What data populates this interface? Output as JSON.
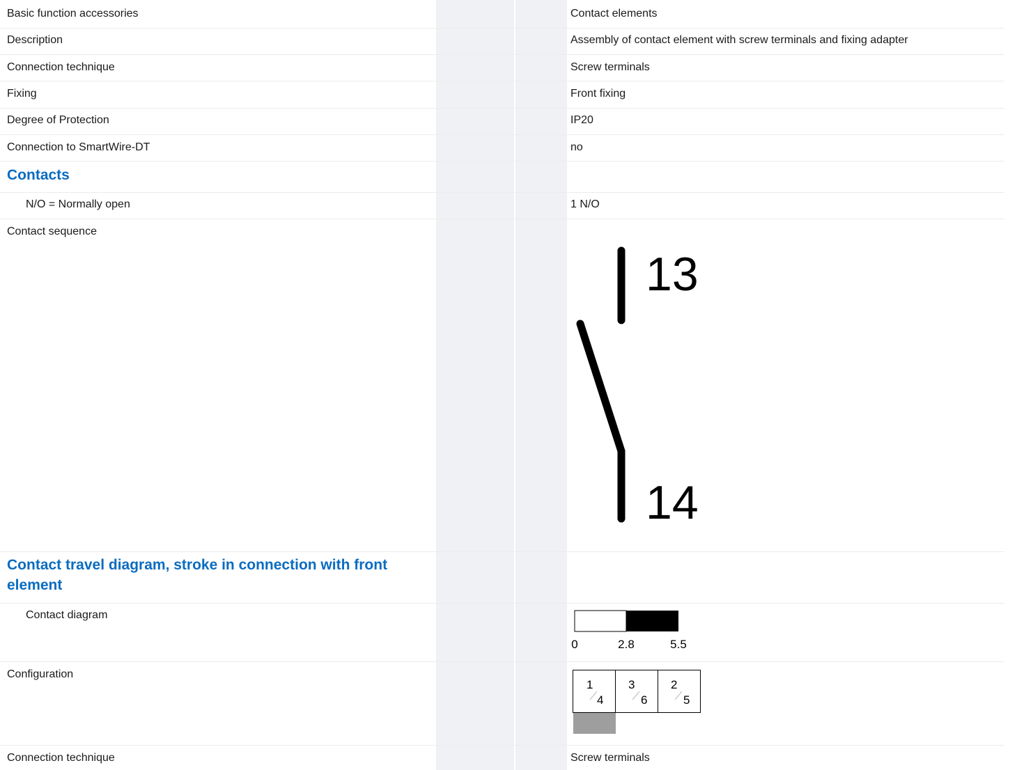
{
  "rows": {
    "basic_function": {
      "label": "Basic function accessories",
      "value": "Contact elements"
    },
    "description": {
      "label": "Description",
      "value": "Assembly of contact element with screw terminals and fixing adapter"
    },
    "connection_technique": {
      "label": "Connection technique",
      "value": "Screw terminals"
    },
    "fixing": {
      "label": "Fixing",
      "value": "Front fixing"
    },
    "degree_of_protection": {
      "label": "Degree of Protection",
      "value": "IP20"
    },
    "smartwire": {
      "label": "Connection to SmartWire-DT",
      "value": "no"
    },
    "contacts_section": {
      "label": "Contacts"
    },
    "normally_open": {
      "label": "N/O = Normally open",
      "value": "1 N/O"
    },
    "contact_sequence": {
      "label": "Contact sequence",
      "terminal_top": "13",
      "terminal_bottom": "14"
    },
    "travel_section": {
      "label": "Contact travel diagram, stroke in connection with front element"
    },
    "contact_diagram": {
      "label": "Contact diagram",
      "ticks": [
        "0",
        "2.8",
        "5.5"
      ]
    },
    "configuration": {
      "label": "Configuration",
      "cells": [
        {
          "num": "1",
          "den": "4"
        },
        {
          "num": "3",
          "den": "6"
        },
        {
          "num": "2",
          "den": "5"
        }
      ]
    },
    "connection_technique_2": {
      "label": "Connection technique",
      "value": "Screw terminals"
    }
  },
  "colors": {
    "section_heading": "#0a6cc0",
    "column_shade": "#f0f1f4",
    "config_marker": "#9e9e9e"
  }
}
